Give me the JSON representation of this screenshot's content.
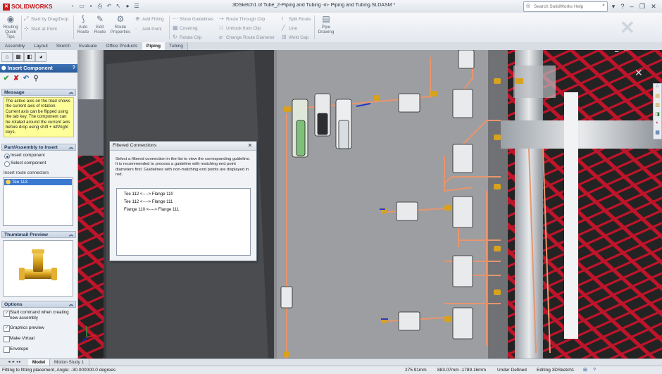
{
  "app": {
    "brand": "SOLIDWORKS",
    "title": "3DSketch1 of Tube_2-Piping and Tubing -in- Piping and Tubing.SLDASM *"
  },
  "search": {
    "placeholder": "Search SolidWorks Help"
  },
  "commands": {
    "routing_quick_tips": "Routing Quick Tips",
    "start_by_drag_drop": "Start by Drag/Drop",
    "start_at_point": "Start at Point",
    "auto_route": "Auto Route",
    "edit_route": "Edit Route",
    "route_properties": "Route Properties",
    "add_fitting": "Add Fitting",
    "add_point": "Add Point",
    "show_guidelines": "Show Guidelines",
    "covering": "Covering",
    "rotate_clip": "Rotate Clip",
    "route_through_clip": "Route Through Clip",
    "unhook_from_clip": "Unhook from Clip",
    "change_route_diameter": "Change Route Diameter",
    "split_route": "Split Route",
    "line": "Line",
    "weld_gap": "Weld Gap",
    "pipe_drawing": "Pipe Drawing"
  },
  "tabs": [
    "Assembly",
    "Layout",
    "Sketch",
    "Evaluate",
    "Office Products",
    "Piping",
    "Tubing"
  ],
  "active_tab": "Piping",
  "panel": {
    "header": "Insert Component",
    "message_title": "Message",
    "message": "The active axis on the triad shows the current axis of rotation. Current axis can be flipped using the tab key. The component can be rotated around the current axis before drop using shift + left/right keys.",
    "part_assembly_title": "Part/Assembly to Insert",
    "insert_component": "Insert component",
    "select_component": "Select component",
    "insert_route_connectors": "Insert route connectors",
    "selected_connector": "Tee 113",
    "thumbnail_title": "Thumbnail Preview",
    "options_title": "Options",
    "opt_start_command": "Start command when creating new assembly",
    "opt_graphics_preview": "Graphics preview",
    "opt_make_virtual": "Make Virtual",
    "opt_envelope": "Envelope"
  },
  "dialog": {
    "title": "Filtered Connections",
    "message": "Select a filtered connection in the list to view the corresponding guideline. It is recommended to process a guideline with matching end point diameters first. Guidelines with non-matching end points are displayed in red.",
    "items": [
      "Tee 112 <----> Flange 110",
      "Tee 112 <----> Flange 111",
      "Flange 110 <----> Flange 111"
    ]
  },
  "bottom_tabs": [
    "Model",
    "Motion Study 1"
  ],
  "status": {
    "message": "Fitting to fitting placement,  Angle: -30.000000.0 degrees",
    "x": "275.91mm",
    "y": "883.07mm -1789.16mm",
    "state": "Under Defined",
    "editing": "Editing 3DSketch1"
  },
  "colors": {
    "panel_header": "#2a5a98",
    "message_bg": "#ffff99",
    "pipe": "#e8956e",
    "floor_red": "#c0142a",
    "selection": "#3a78d0"
  }
}
